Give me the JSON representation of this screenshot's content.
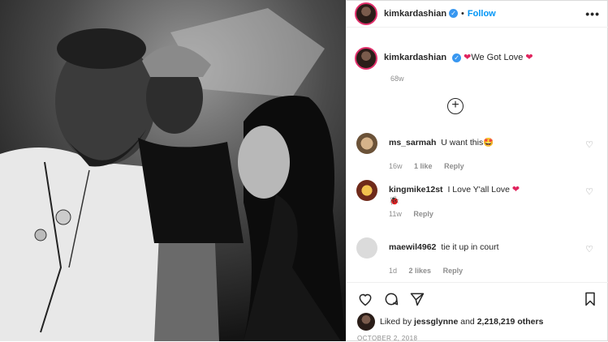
{
  "header": {
    "username": "kimkardashian",
    "follow_label": "Follow",
    "dot": "•",
    "more": "•••"
  },
  "caption": {
    "username": "kimkardashian",
    "text": "We Got Love",
    "age": "68w"
  },
  "comments": [
    {
      "username": "ms_sarmah",
      "text": "U want this🤩",
      "age": "16w",
      "likes": "1 like",
      "reply": "Reply"
    },
    {
      "username": "kingmike12st",
      "text": "I Love Y'all Love",
      "text2": "🐞",
      "age": "11w",
      "likes": "",
      "reply": "Reply"
    },
    {
      "username": "maewil4962",
      "text": "tie it up in court",
      "age": "1d",
      "likes": "2 likes",
      "reply": "Reply"
    }
  ],
  "likes": {
    "prefix": "Liked by",
    "user": "jessglynne",
    "and": "and",
    "count": "2,218,219 others"
  },
  "date": "OCTOBER 2, 2018",
  "colors": {
    "follow": "#0095f6",
    "heart": "#e0245e",
    "muted": "#8e8e8e"
  }
}
